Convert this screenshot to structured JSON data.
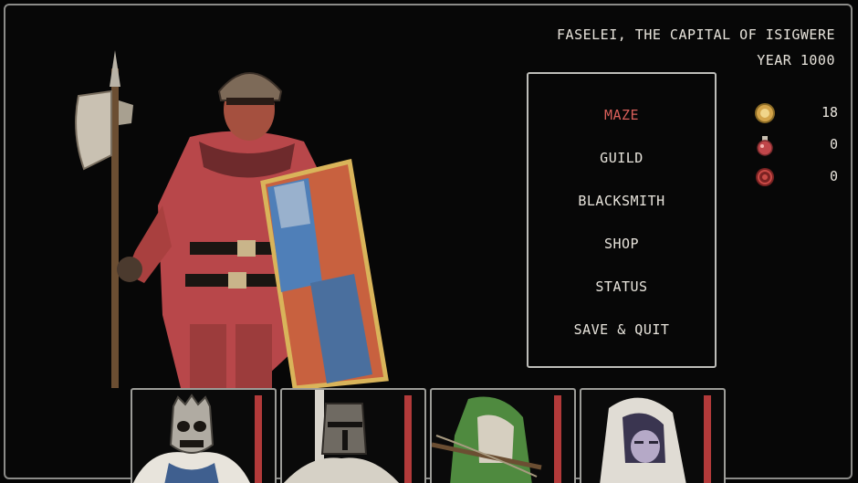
{
  "location": {
    "name": "FASELEI, THE CAPITAL OF ISIGWERE",
    "year": "YEAR 1000"
  },
  "menu": {
    "items": [
      {
        "label": "MAZE",
        "selected": true
      },
      {
        "label": "GUILD",
        "selected": false
      },
      {
        "label": "BLACKSMITH",
        "selected": false
      },
      {
        "label": "SHOP",
        "selected": false
      },
      {
        "label": "STATUS",
        "selected": false
      },
      {
        "label": "SAVE & QUIT",
        "selected": false
      }
    ]
  },
  "resources": [
    {
      "icon": "gold-coin-icon",
      "value": "18"
    },
    {
      "icon": "potion-icon",
      "value": "0"
    },
    {
      "icon": "red-orb-icon",
      "value": "0"
    }
  ],
  "party": [
    {
      "icon": "skull-knight-portrait",
      "hp_fraction": 1.0
    },
    {
      "icon": "great-helm-knight-portrait",
      "hp_fraction": 1.0
    },
    {
      "icon": "hooded-archer-portrait",
      "hp_fraction": 1.0
    },
    {
      "icon": "hooded-mage-portrait",
      "hp_fraction": 1.0
    }
  ],
  "colors": {
    "accent_selected": "#d95f5a",
    "hp_bar": "#b23a3a",
    "text": "#e8e4dc"
  }
}
